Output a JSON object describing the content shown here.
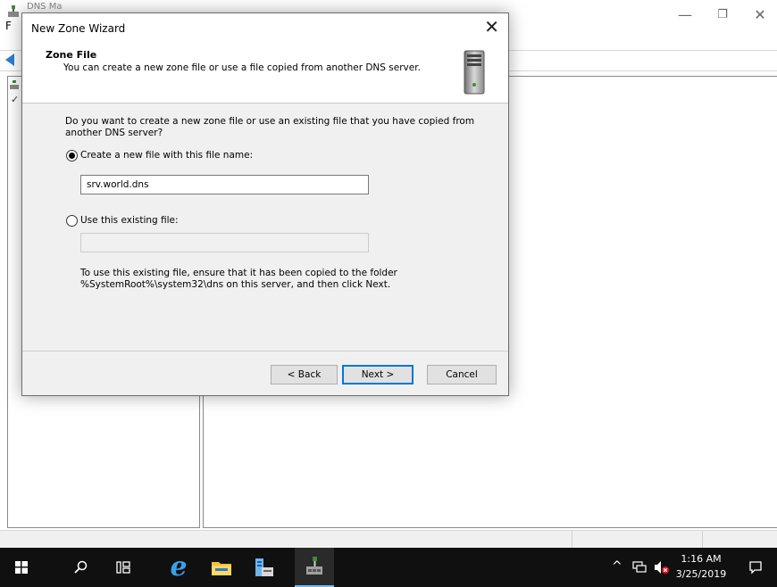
{
  "background_window": {
    "title_partial": "DNS Ma",
    "menu_first": "F",
    "controls": {
      "minimize": "—",
      "restore": "❐",
      "close": "✕"
    },
    "tree_chevron": "✓"
  },
  "dialog": {
    "title": "New Zone Wizard",
    "close_glyph": "✕",
    "heading": "Zone File",
    "subheading": "You can create a new zone file or use a file copied from another DNS server.",
    "question": "Do you want to create a new zone file or use an existing file that you have copied from another DNS server?",
    "option_new": {
      "label": "Create a new file with this file name:",
      "selected": true,
      "value": "srv.world.dns"
    },
    "option_existing": {
      "label": "Use this existing file:",
      "selected": false,
      "value": ""
    },
    "info": "To use this existing file, ensure that it has been copied to the folder %SystemRoot%\\system32\\dns on this server, and then click Next.",
    "buttons": {
      "back": "< Back",
      "next": "Next >",
      "cancel": "Cancel"
    }
  },
  "taskbar": {
    "icons": [
      "windows-start-icon",
      "search-icon",
      "task-view-icon",
      "internet-explorer-icon",
      "file-explorer-icon",
      "server-manager-icon",
      "dns-manager-icon"
    ],
    "tray_chevron": "^",
    "clock_time": "1:16 AM",
    "clock_date": "3/25/2019"
  },
  "colors": {
    "accent": "#0078d7",
    "taskbar": "#101010",
    "dialog_bg": "#f0f0f0"
  }
}
